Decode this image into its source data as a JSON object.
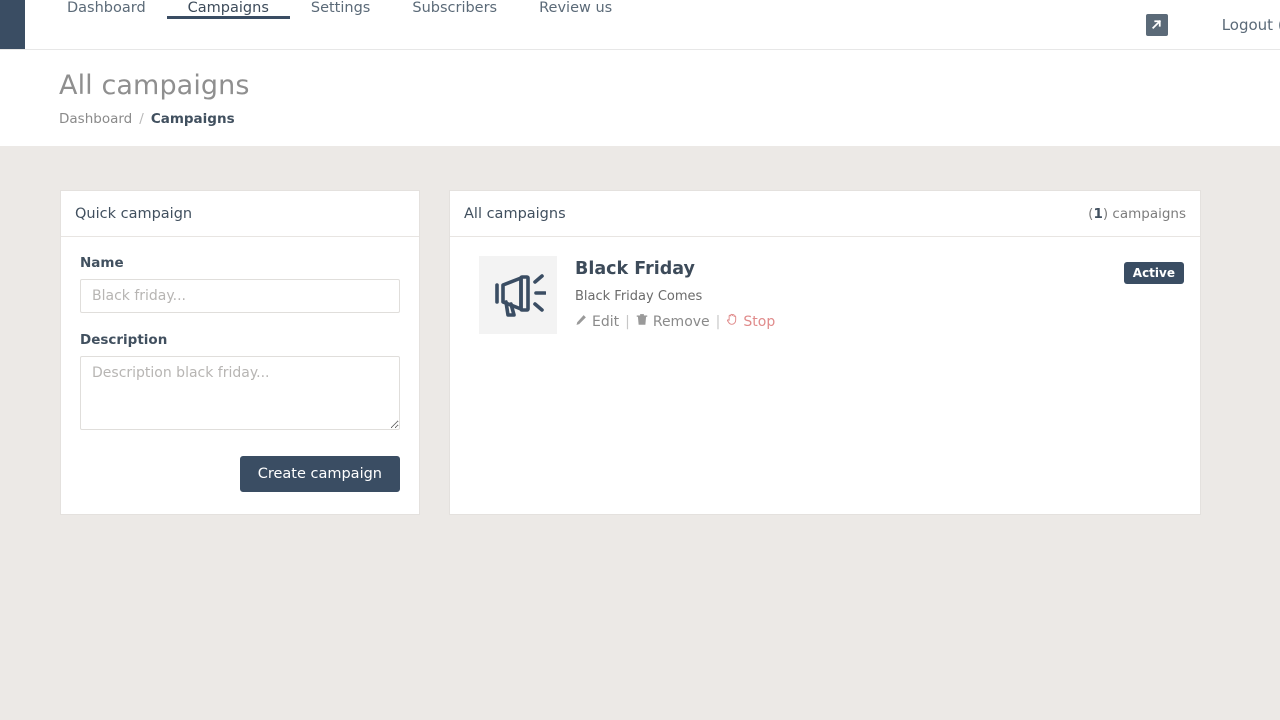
{
  "navbar": {
    "brand_color": "#3a4d63",
    "items": [
      {
        "label": "Dashboard",
        "active": false
      },
      {
        "label": "Campaigns",
        "active": true
      },
      {
        "label": "Settings",
        "active": false
      },
      {
        "label": "Subscribers",
        "active": false
      },
      {
        "label": "Review us",
        "active": false
      }
    ],
    "external_link_icon": "external-link-icon",
    "logout_label": "Logout (spintowin..."
  },
  "page_header": {
    "title": "All campaigns",
    "breadcrumb": {
      "root": "Dashboard",
      "separator": "/",
      "current": "Campaigns"
    }
  },
  "quick_campaign": {
    "title": "Quick campaign",
    "name_label": "Name",
    "name_value": "",
    "name_placeholder": "Black friday...",
    "description_label": "Description",
    "description_value": "",
    "description_placeholder": "Description black friday...",
    "submit_label": "Create campaign",
    "submit_color": "#3a4d63"
  },
  "all_campaigns": {
    "title": "All campaigns",
    "count": "1",
    "count_suffix": ") campaigns",
    "count_prefix": "(",
    "rows": [
      {
        "thumb_icon": "megaphone-icon",
        "name": "Black Friday",
        "description": "Black Friday Comes",
        "actions": {
          "edit": "Edit",
          "remove": "Remove",
          "stop": "Stop",
          "divider": "|"
        },
        "status": "Active",
        "status_color": "#3a4d63"
      }
    ]
  }
}
